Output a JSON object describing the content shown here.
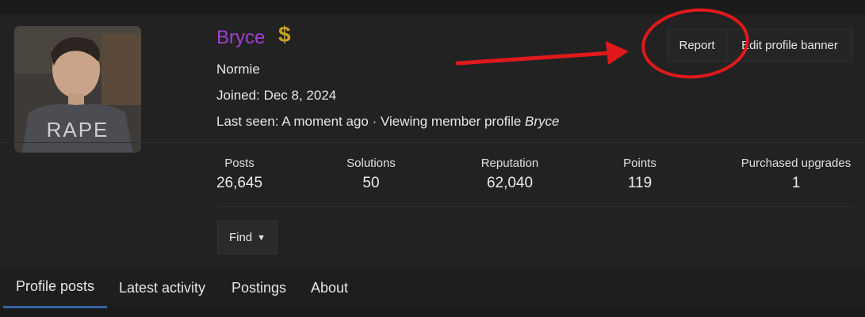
{
  "profile": {
    "username": "Bryce",
    "avatar_shirt_text": "RAPE",
    "badge_icon": "dollar-icon",
    "badge_glyph": "$",
    "title": "Normie",
    "joined_label": "Joined:",
    "joined_value": "Dec 8, 2024",
    "last_seen_label": "Last seen:",
    "last_seen_value": "A moment ago · Viewing member profile",
    "last_seen_target": "Bryce"
  },
  "actions": {
    "report_label": "Report",
    "edit_banner_label": "Edit profile banner"
  },
  "stats": [
    {
      "label": "Posts",
      "value": "26,645"
    },
    {
      "label": "Solutions",
      "value": "50"
    },
    {
      "label": "Reputation",
      "value": "62,040"
    },
    {
      "label": "Points",
      "value": "119"
    },
    {
      "label": "Purchased upgrades",
      "value": "1"
    }
  ],
  "find": {
    "label": "Find"
  },
  "tabs": [
    {
      "label": "Profile posts",
      "active": true
    },
    {
      "label": "Latest activity",
      "active": false
    },
    {
      "label": "Postings",
      "active": false
    },
    {
      "label": "About",
      "active": false
    }
  ],
  "colors": {
    "username": "#a03fd0",
    "badge": "#c8a12b",
    "annotation": "#e0191b",
    "active_tab": "#3465a4"
  }
}
